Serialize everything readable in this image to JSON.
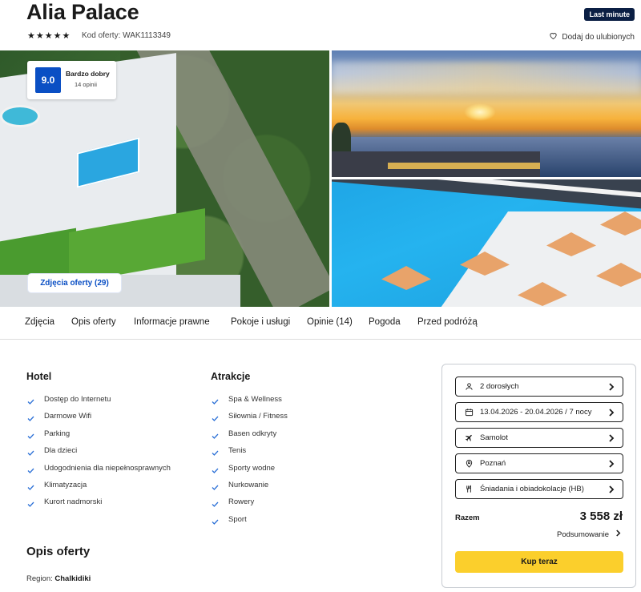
{
  "header": {
    "title": "Alia Palace",
    "badge": "Last minute",
    "stars": "★★★★★",
    "offer_code": "Kod oferty: WAK1113349",
    "favorite_label": "Dodaj do ulubionych"
  },
  "rating": {
    "score": "9.0",
    "label": "Bardzo dobry",
    "count": "14 opinii"
  },
  "gallery": {
    "photos_button": "Zdjęcia oferty (29)"
  },
  "tabs": [
    "Zdjęcia",
    "Opis oferty",
    "Informacje prawne",
    "Pokoje i usługi",
    "Opinie (14)",
    "Pogoda",
    "Przed podróżą"
  ],
  "hotel": {
    "heading": "Hotel",
    "items": [
      "Dostęp do Internetu",
      "Darmowe Wifi",
      "Parking",
      "Dla dzieci",
      "Udogodnienia dla niepełnosprawnych",
      "Klimatyzacja",
      "Kurort nadmorski"
    ]
  },
  "attractions": {
    "heading": "Atrakcje",
    "items": [
      "Spa & Wellness",
      "Siłownia / Fitness",
      "Basen odkryty",
      "Tenis",
      "Sporty wodne",
      "Nurkowanie",
      "Rowery",
      "Sport"
    ]
  },
  "description": {
    "heading": "Opis oferty",
    "region_label": "Region:",
    "region_value": "Chalkidiki"
  },
  "booking": {
    "options": [
      {
        "icon": "person-icon",
        "label": "2 dorosłych"
      },
      {
        "icon": "calendar-icon",
        "label": "13.04.2026 - 20.04.2026 / 7 nocy"
      },
      {
        "icon": "plane-icon",
        "label": "Samolot"
      },
      {
        "icon": "location-pin-icon",
        "label": "Poznań"
      },
      {
        "icon": "cutlery-icon",
        "label": "Śniadania i obiadokolacje (HB)"
      }
    ],
    "total_label": "Razem",
    "total_value": "3 558 zł",
    "summary_label": "Podsumowanie",
    "buy_label": "Kup teraz"
  },
  "colors": {
    "accent": "#0a4fc4",
    "buy": "#fbcf2c",
    "badge": "#0b1f44",
    "check": "#2a6fd6"
  }
}
